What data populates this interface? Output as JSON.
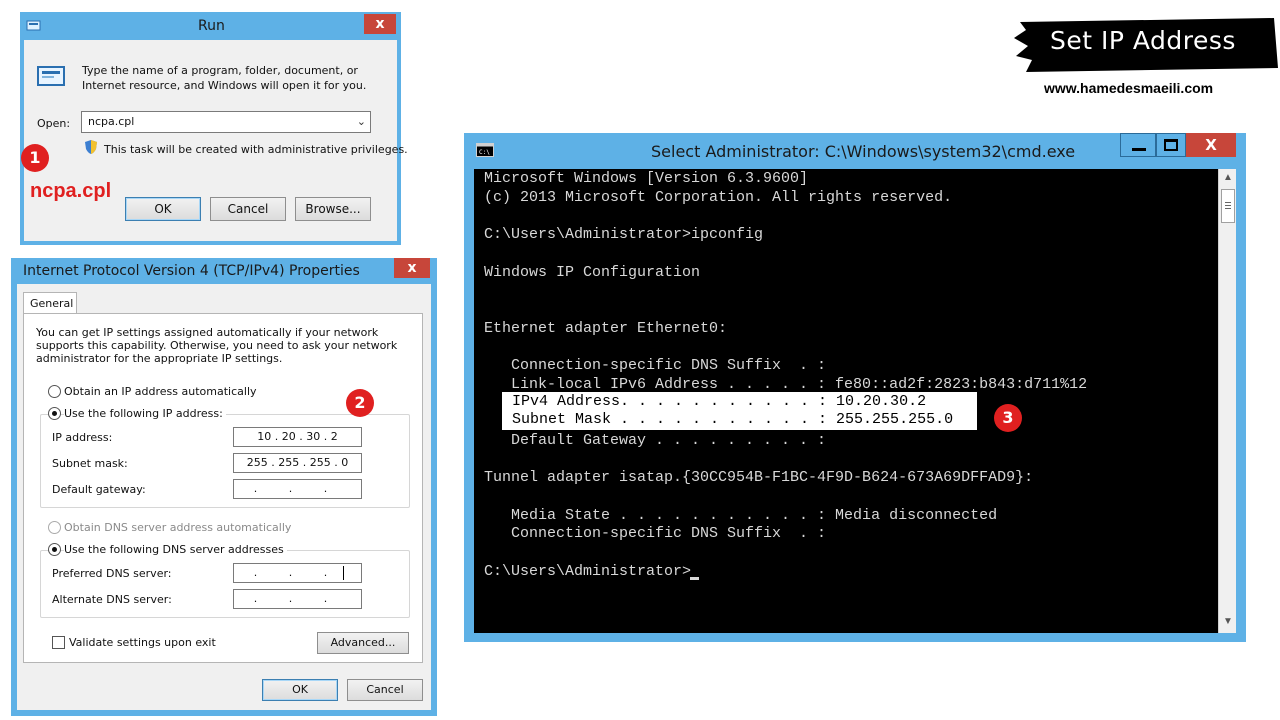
{
  "banner": {
    "title": "Set IP Address",
    "website": "www.hamedesmaeili.com"
  },
  "run_dialog": {
    "title": "Run",
    "description_line1": "Type the name of a program, folder, document, or",
    "description_line2": "Internet resource, and Windows will open it for you.",
    "open_label": "Open:",
    "open_value": "ncpa.cpl",
    "admin_note": "This task will be created with administrative privileges.",
    "ok_label": "OK",
    "cancel_label": "Cancel",
    "browse_label": "Browse...",
    "close_label": "x"
  },
  "step1": {
    "number": "1",
    "caption": "ncpa.cpl"
  },
  "step2": {
    "number": "2"
  },
  "step3": {
    "number": "3"
  },
  "ipv4_dialog": {
    "title": "Internet Protocol Version 4 (TCP/IPv4) Properties",
    "close_label": "x",
    "tab_general": "General",
    "intro_line1": "You can get IP settings assigned automatically if your network",
    "intro_line2": "supports this capability. Otherwise, you need to ask your network",
    "intro_line3": "administrator for the appropriate IP settings.",
    "radio_auto_ip": "Obtain an IP address automatically",
    "radio_static_ip": "Use the following IP address:",
    "ip_label": "IP address:",
    "ip_value": "10 . 20 . 30 . 2",
    "mask_label": "Subnet mask:",
    "mask_value": "255 . 255 . 255 . 0",
    "gateway_label": "Default gateway:",
    "gateway_value": ". . .",
    "radio_auto_dns": "Obtain DNS server address automatically",
    "radio_static_dns": "Use the following DNS server addresses",
    "pref_dns_label": "Preferred DNS server:",
    "pref_dns_value": ". . .",
    "alt_dns_label": "Alternate DNS server:",
    "alt_dns_value": ". . .",
    "validate_label": "Validate settings upon exit",
    "advanced_label": "Advanced...",
    "ok_label": "OK",
    "cancel_label": "Cancel"
  },
  "cmd_window": {
    "title": "Select Administrator: C:\\Windows\\system32\\cmd.exe",
    "minimize_label": "—",
    "maximize_label": "□",
    "close_label": "X",
    "lines": [
      "Microsoft Windows [Version 6.3.9600]",
      "(c) 2013 Microsoft Corporation. All rights reserved.",
      "",
      "C:\\Users\\Administrator>ipconfig",
      "",
      "Windows IP Configuration",
      "",
      "",
      "Ethernet adapter Ethernet0:",
      "",
      "   Connection-specific DNS Suffix  . :",
      "   Link-local IPv6 Address . . . . . : fe80::ad2f:2823:b843:d711%12"
    ],
    "highlight_lines": [
      "IPv4 Address. . . . . . . . . . . : 10.20.30.2",
      "Subnet Mask . . . . . . . . . . . : 255.255.255.0"
    ],
    "lines_after": [
      "   Default Gateway . . . . . . . . . :",
      "",
      "Tunnel adapter isatap.{30CC954B-F1BC-4F9D-B624-673A69DFFAD9}:",
      "",
      "   Media State . . . . . . . . . . . : Media disconnected",
      "   Connection-specific DNS Suffix  . :",
      "",
      "C:\\Users\\Administrator>"
    ]
  }
}
